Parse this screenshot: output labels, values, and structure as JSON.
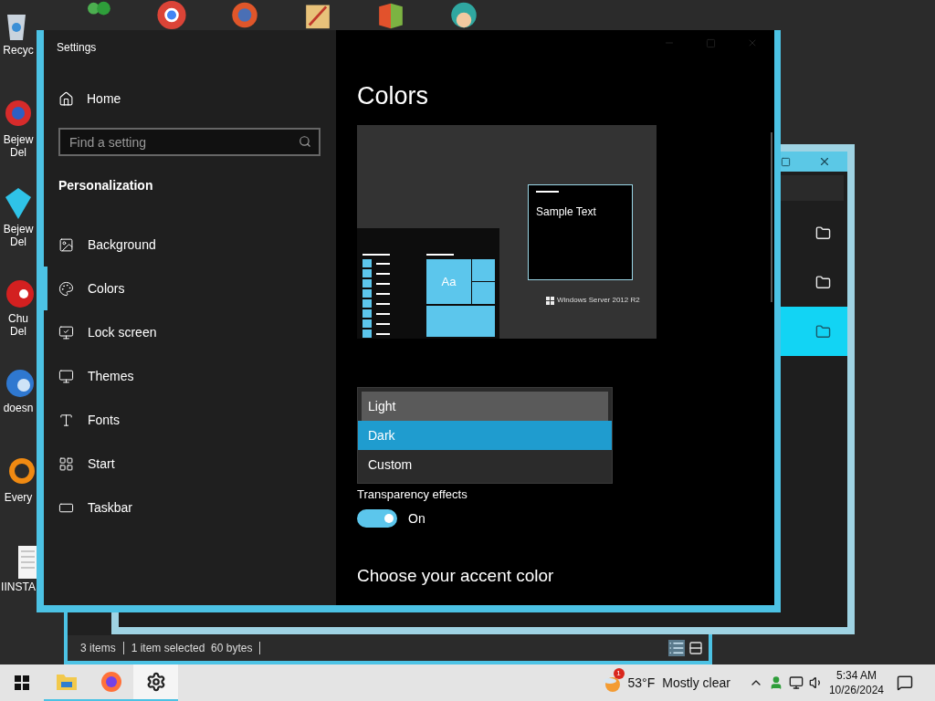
{
  "desktop": {
    "top_icons": [
      {
        "kind": "people"
      },
      {
        "kind": "chrome"
      },
      {
        "kind": "swirl"
      },
      {
        "kind": "paint"
      },
      {
        "kind": "office"
      },
      {
        "kind": "character"
      }
    ],
    "icons": [
      {
        "kind": "bin",
        "lines": [
          "Recyc"
        ]
      },
      {
        "kind": "gem-red",
        "lines": [
          "Bejew",
          "Del"
        ]
      },
      {
        "kind": "gem-blue",
        "lines": [
          "Bejew",
          "Del"
        ]
      },
      {
        "kind": "ball",
        "lines": [
          "Chu",
          "Del"
        ]
      },
      {
        "kind": "bird",
        "lines": [
          "doesn"
        ]
      },
      {
        "kind": "ring",
        "lines": [
          "Every"
        ]
      },
      {
        "kind": "doc",
        "lines": [
          "IINSTA"
        ]
      }
    ]
  },
  "explorer_back": {
    "folders": [
      {
        "selected": false
      },
      {
        "selected": false
      },
      {
        "selected": true
      }
    ]
  },
  "explorer_status": {
    "items": "3 items",
    "selection": "1 item selected  60 bytes"
  },
  "settings": {
    "title": "Settings",
    "home": "Home",
    "search": {
      "placeholder": "Find a setting"
    },
    "section": "Personalization",
    "nav": [
      {
        "label": "Background",
        "selected": false
      },
      {
        "label": "Colors",
        "selected": true
      },
      {
        "label": "Lock screen",
        "selected": false
      },
      {
        "label": "Themes",
        "selected": false
      },
      {
        "label": "Fonts",
        "selected": false
      },
      {
        "label": "Start",
        "selected": false
      },
      {
        "label": "Taskbar",
        "selected": false
      }
    ],
    "page_title": "Colors",
    "preview": {
      "tile_label": "Aa",
      "sample_text": "Sample Text",
      "os_label": "Windows Server 2012 R2"
    },
    "mode_options": [
      {
        "label": "Light",
        "selected": false,
        "hovered": true
      },
      {
        "label": "Dark",
        "selected": true,
        "hovered": false
      },
      {
        "label": "Custom",
        "selected": false,
        "hovered": false
      }
    ],
    "transparency": {
      "label": "Transparency effects",
      "on": true,
      "state_text": "On"
    },
    "accent_heading": "Choose your accent color"
  },
  "taskbar": {
    "apps": [
      {
        "kind": "explorer",
        "active": false
      },
      {
        "kind": "firefox",
        "active": false
      },
      {
        "kind": "settings",
        "active": true
      }
    ],
    "weather": {
      "badge": "1",
      "temp": "53°F",
      "condition": "Mostly clear"
    },
    "clock": {
      "time": "5:34 AM",
      "date": "10/26/2024"
    }
  }
}
